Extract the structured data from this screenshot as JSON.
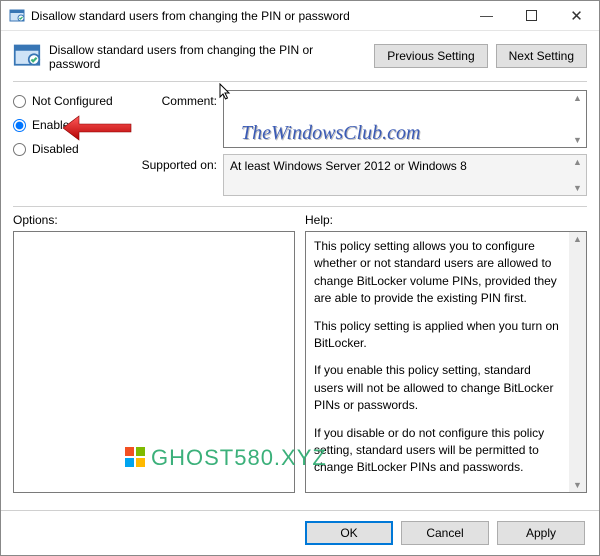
{
  "window": {
    "title": "Disallow standard users from changing the PIN or password"
  },
  "header": {
    "title": "Disallow standard users from changing the PIN or password",
    "prev_btn": "Previous Setting",
    "next_btn": "Next Setting"
  },
  "radios": {
    "not_configured": "Not Configured",
    "enabled": "Enabled",
    "disabled": "Disabled",
    "selected": "enabled"
  },
  "fields": {
    "comment_label": "Comment:",
    "comment_value": "",
    "supported_label": "Supported on:",
    "supported_value": "At least Windows Server 2012 or Windows 8"
  },
  "panes": {
    "options_label": "Options:",
    "help_label": "Help:",
    "help_paragraphs": [
      "This policy setting allows you to configure whether or not standard users are allowed to change BitLocker volume PINs, provided they are able to provide the existing PIN first.",
      "This policy setting is applied when you turn on BitLocker.",
      "If you enable this policy setting, standard users will not be allowed to change BitLocker PINs or passwords.",
      "If you disable or do not configure this policy setting, standard users will be permitted to change BitLocker PINs and passwords."
    ]
  },
  "footer": {
    "ok": "OK",
    "cancel": "Cancel",
    "apply": "Apply"
  },
  "watermarks": {
    "site1": "TheWindowsClub.com",
    "site2": "GHOST580.XYZ"
  }
}
